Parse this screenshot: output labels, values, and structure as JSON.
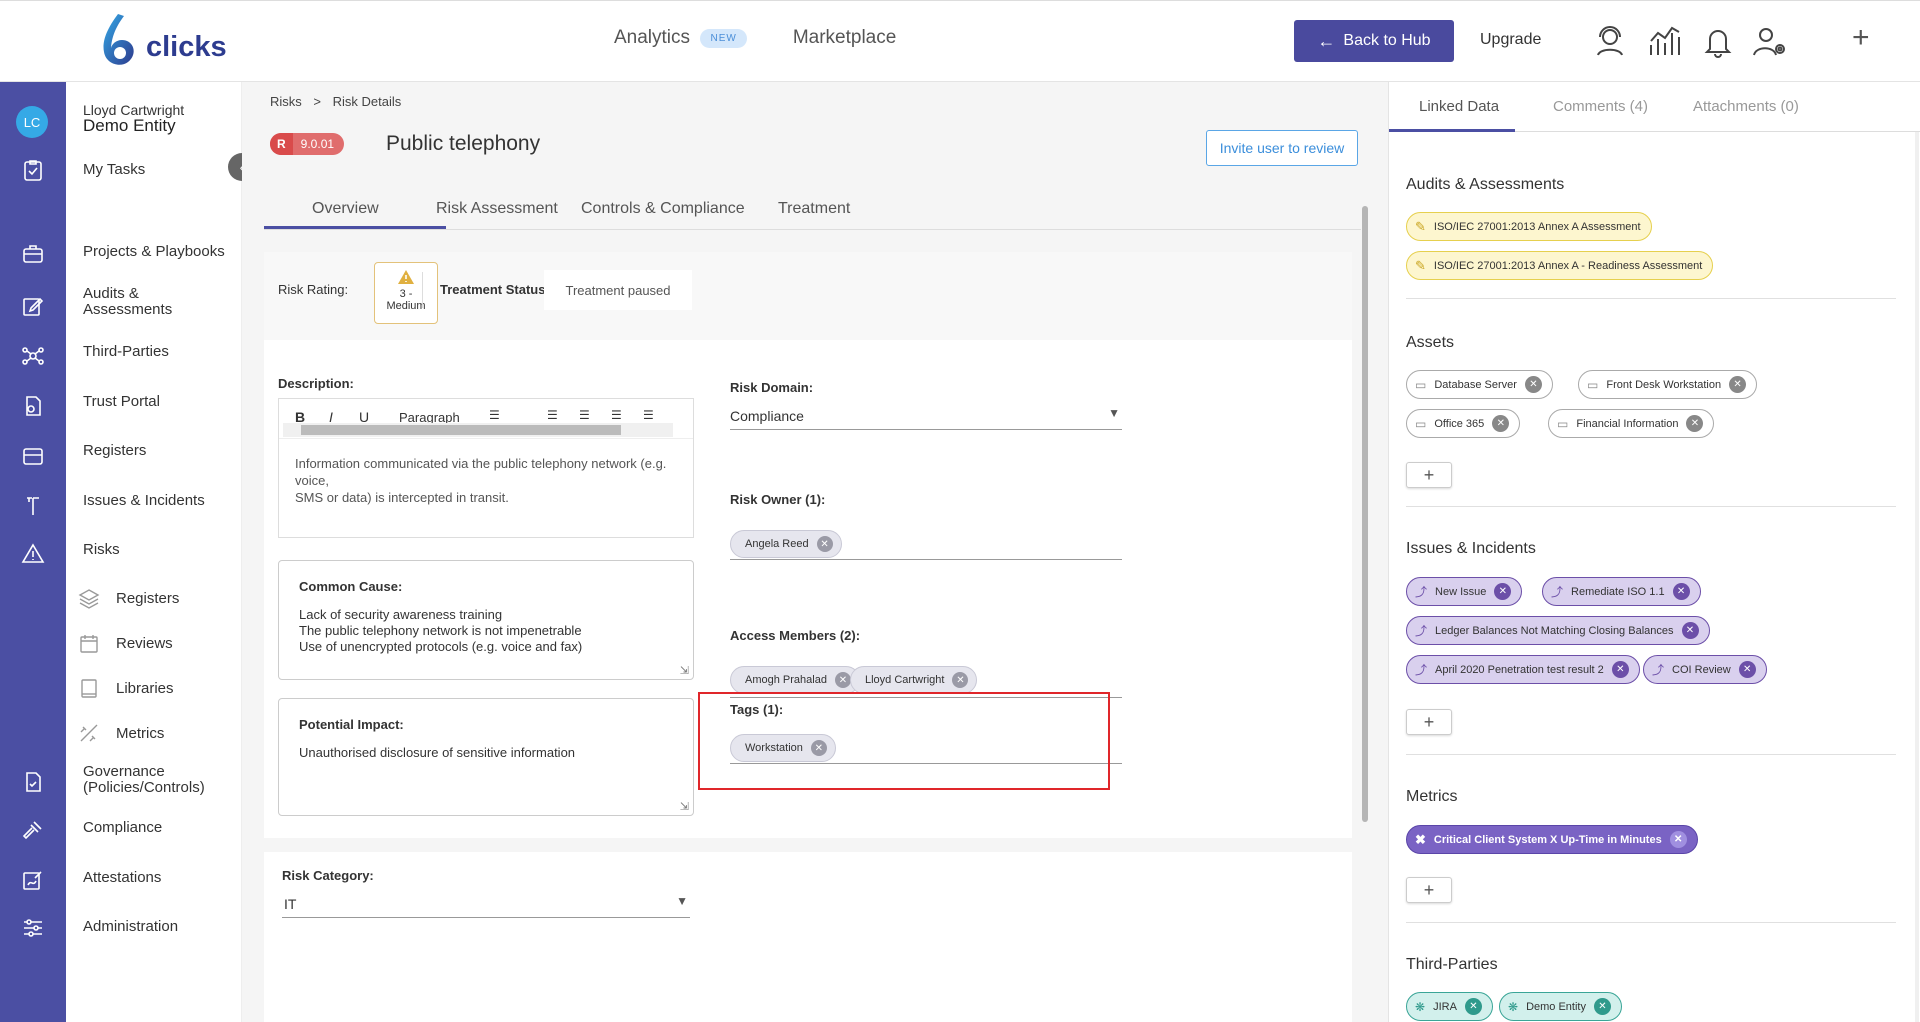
{
  "header": {
    "logo_text": "clicks",
    "nav": [
      {
        "label": "Analytics",
        "badge": "NEW"
      },
      {
        "label": "Marketplace"
      }
    ],
    "back_to_hub": "Back to Hub",
    "upgrade": "Upgrade",
    "add": "+"
  },
  "user": {
    "initials": "LC",
    "name": "Lloyd Cartwright",
    "entity": "Demo Entity"
  },
  "sidenav": {
    "my_tasks": "My Tasks",
    "projects": "Projects & Playbooks",
    "audits_l1": "Audits &",
    "audits_l2": "Assessments",
    "third_parties": "Third-Parties",
    "trust_portal": "Trust Portal",
    "registers": "Registers",
    "issues": "Issues & Incidents",
    "risks": "Risks",
    "sub_registers": "Registers",
    "sub_reviews": "Reviews",
    "sub_libraries": "Libraries",
    "sub_metrics": "Metrics",
    "gov_l1": "Governance",
    "gov_l2": "(Policies/Controls)",
    "compliance": "Compliance",
    "attestations": "Attestations",
    "administration": "Administration"
  },
  "breadcrumb": {
    "root": "Risks",
    "sep": ">",
    "current": "Risk Details"
  },
  "risk": {
    "prefix": "R",
    "code": "9.0.01",
    "title": "Public telephony",
    "invite": "Invite user to review"
  },
  "tabs": {
    "overview": "Overview",
    "assessment": "Risk Assessment",
    "controls": "Controls & Compliance",
    "treatment": "Treatment"
  },
  "rating": {
    "label": "Risk Rating:",
    "value_l1": "3 -",
    "value_l2": "Medium",
    "status_label": "Treatment Status:",
    "status_value": "Treatment paused"
  },
  "description": {
    "label": "Description:",
    "toolbar_b": "B",
    "toolbar_i": "I",
    "toolbar_u": "U",
    "toolbar_paragraph": "Paragraph",
    "text_l1": "Information communicated via the public telephony network (e.g. voice,",
    "text_l2": "SMS or data) is intercepted in transit."
  },
  "common_cause": {
    "label": "Common Cause:",
    "l1": "Lack of security awareness training",
    "l2": "The public telephony network is not impenetrable",
    "l3": "Use of unencrypted protocols (e.g. voice and fax)"
  },
  "potential_impact": {
    "label": "Potential Impact:",
    "text": "Unauthorised disclosure of sensitive information"
  },
  "risk_domain": {
    "label": "Risk Domain:",
    "value": "Compliance"
  },
  "risk_owner": {
    "label": "Risk Owner (1):",
    "chips": [
      "Angela Reed"
    ]
  },
  "access_members": {
    "label": "Access Members (2):",
    "chips": [
      "Amogh Prahalad",
      "Lloyd Cartwright"
    ]
  },
  "tags": {
    "label": "Tags (1):",
    "chips": [
      "Workstation"
    ]
  },
  "risk_category": {
    "label": "Risk Category:",
    "value": "IT"
  },
  "right_panel": {
    "tabs": {
      "linked": "Linked Data",
      "comments": "Comments (4)",
      "attachments": "Attachments (0)"
    },
    "audits": {
      "title": "Audits & Assessments",
      "items": [
        "ISO/IEC 27001:2013 Annex A Assessment",
        "ISO/IEC 27001:2013 Annex A - Readiness Assessment"
      ]
    },
    "assets": {
      "title": "Assets",
      "items": [
        "Database Server",
        "Front Desk Workstation",
        "Office 365",
        "Financial Information"
      ]
    },
    "issues": {
      "title": "Issues & Incidents",
      "items": [
        "New Issue",
        "Remediate ISO 1.1",
        "Ledger Balances Not Matching Closing Balances",
        "April 2020 Penetration test result 2",
        "COI Review"
      ]
    },
    "metrics": {
      "title": "Metrics",
      "items": [
        "Critical Client System X Up-Time in Minutes"
      ]
    },
    "third_parties": {
      "title": "Third-Parties",
      "items": [
        "JIRA",
        "Demo Entity"
      ]
    },
    "add": "+"
  },
  "colors": {
    "brand": "#4b4fa3",
    "accent": "#35a9e6",
    "highlight": "#e0262a"
  }
}
